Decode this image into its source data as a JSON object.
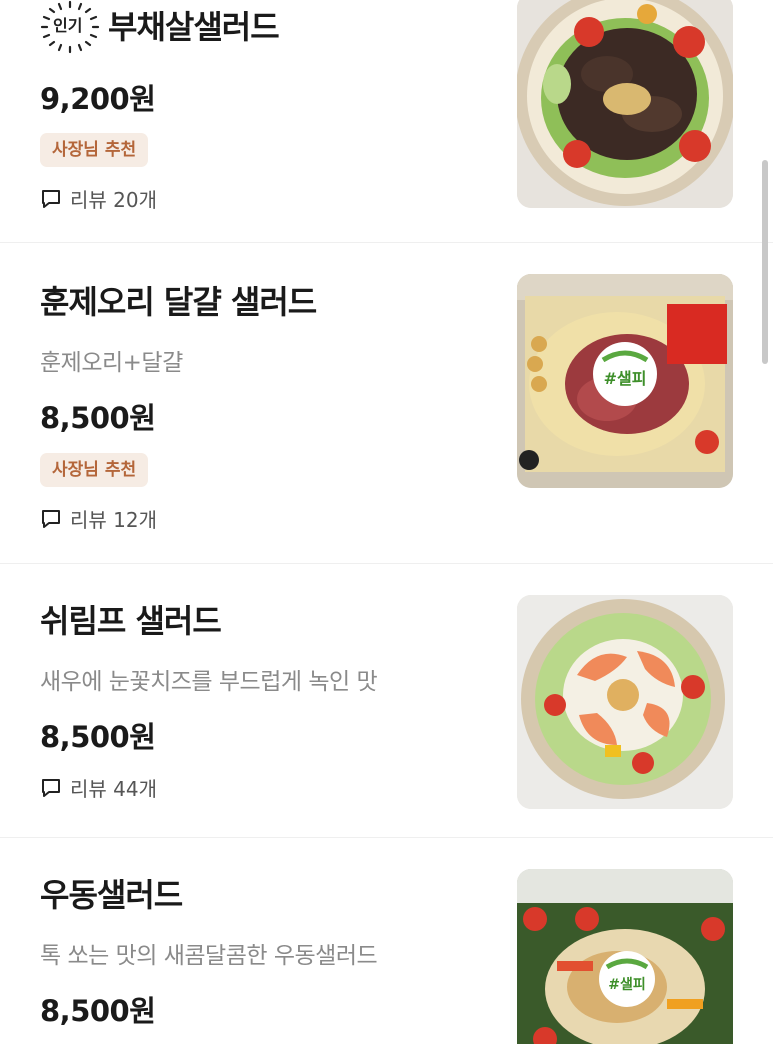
{
  "items": [
    {
      "name": "부채살샐러드",
      "popular_tag": "인기",
      "description": "",
      "price": "9,200원",
      "badge": "사장님 추천",
      "review": "리뷰 20개",
      "image": "beef-salad-photo"
    },
    {
      "name": "훈제오리 달걀 샐러드",
      "description": "훈제오리+달걀",
      "price": "8,500원",
      "badge": "사장님 추천",
      "review": "리뷰 12개",
      "image": "duck-egg-salad-photo",
      "logo_text": "#샐피"
    },
    {
      "name": "쉬림프 샐러드",
      "description": "새우에 눈꽃치즈를 부드럽게 녹인 맛",
      "price": "8,500원",
      "review": "리뷰 44개",
      "image": "shrimp-salad-photo"
    },
    {
      "name": "우동샐러드",
      "description": "톡 쏘는 맛의 새콤달콤한 우동샐러드",
      "price": "8,500원",
      "image": "udon-salad-photo",
      "logo_text": "#샐피"
    }
  ],
  "colors": {
    "badge_bg": "#f6ece4",
    "badge_text": "#b4663a",
    "divider": "#efefef",
    "muted_text": "#8a8a8a"
  }
}
